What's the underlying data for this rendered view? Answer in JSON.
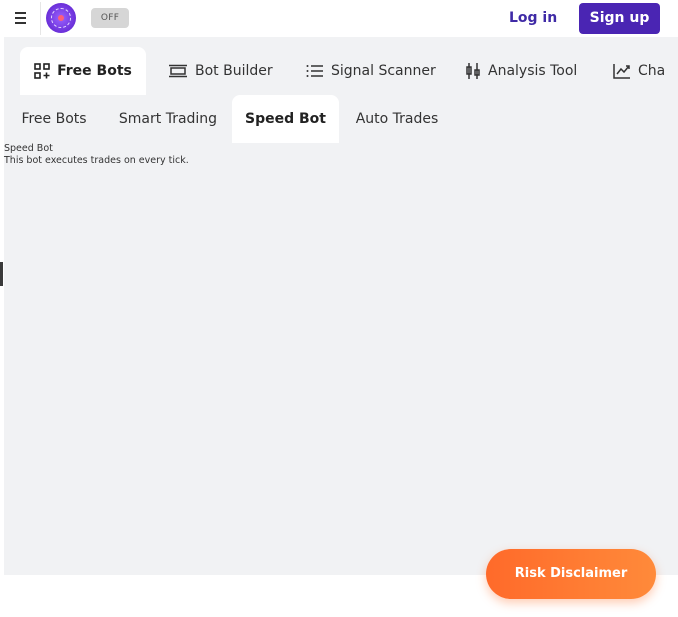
{
  "header": {
    "toggle_label": "OFF",
    "login_label": "Log in",
    "signup_label": "Sign up"
  },
  "main_tabs": [
    {
      "label": "Free Bots",
      "icon": "grid-plus-icon",
      "active": true
    },
    {
      "label": "Bot Builder",
      "icon": "stack-icon",
      "active": false
    },
    {
      "label": "Signal Scanner",
      "icon": "list-icon",
      "active": false
    },
    {
      "label": "Analysis Tool",
      "icon": "candlestick-icon",
      "active": false
    },
    {
      "label": "Cha",
      "icon": "trend-chart-icon",
      "active": false
    }
  ],
  "sub_tabs": [
    {
      "label": "Free Bots",
      "active": false
    },
    {
      "label": "Smart Trading",
      "active": false
    },
    {
      "label": "Speed Bot",
      "active": true
    },
    {
      "label": "Auto Trades",
      "active": false
    }
  ],
  "page": {
    "title": "Speed Bot",
    "description": "This bot executes trades on every tick."
  },
  "risk_disclaimer_label": "Risk Disclaimer",
  "colors": {
    "brand": "#4a25b3",
    "accent_orange": "#ff6a2a",
    "content_bg": "#f1f2f4"
  }
}
